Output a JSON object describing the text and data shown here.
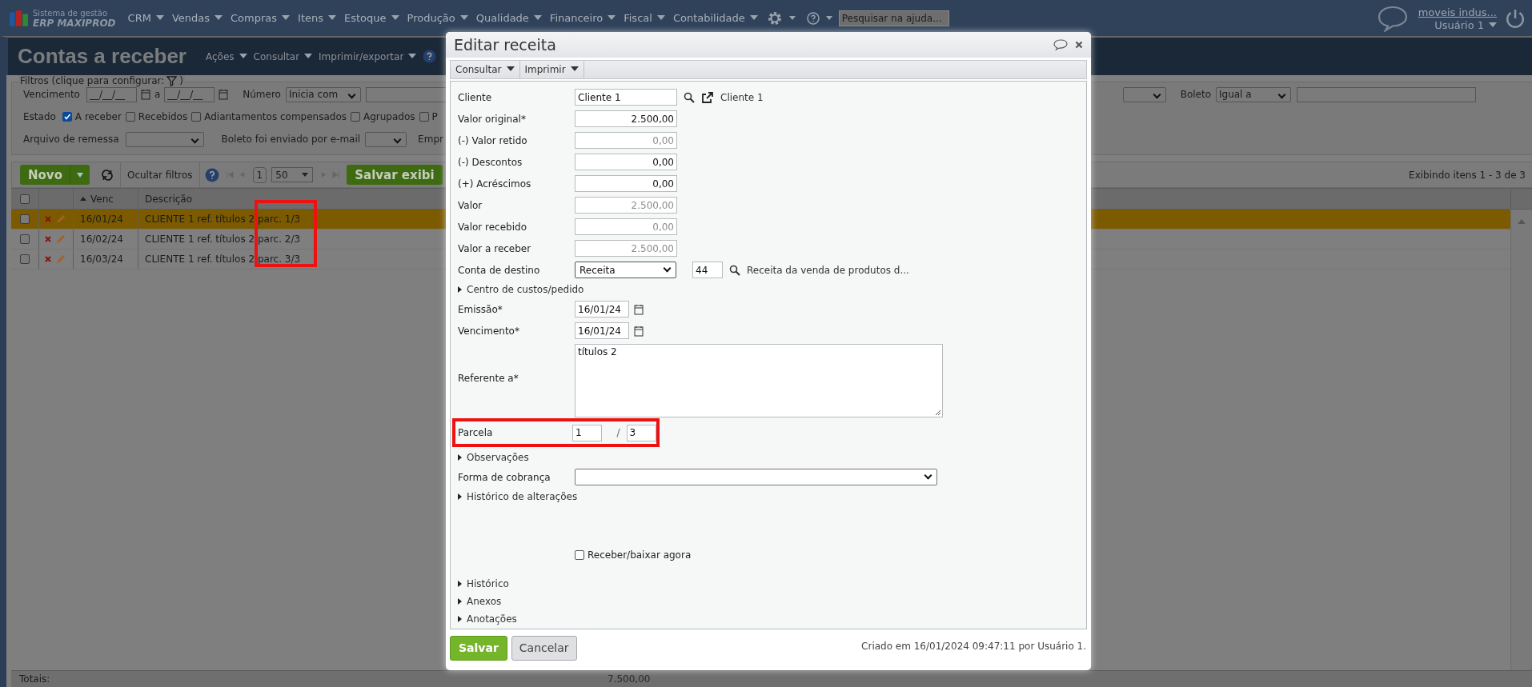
{
  "nav": {
    "logo_line1": "Sistema de gestão",
    "logo_line2": "ERP MAXIPROD",
    "menus": [
      "CRM",
      "Vendas",
      "Compras",
      "Itens",
      "Estoque",
      "Produção",
      "Qualidade",
      "Financeiro",
      "Fiscal",
      "Contabilidade"
    ],
    "search": {
      "placeholder": "Pesquisar na ajuda..."
    },
    "company": "moveis indus...",
    "user": "Usuário 1"
  },
  "page": {
    "title": "Contas a receber",
    "menus": [
      "Ações",
      "Consultar",
      "Imprimir/exportar"
    ]
  },
  "filters": {
    "legend": "Filtros (clique para configurar:",
    "legend_end": ")",
    "vencimento_label": "Vencimento",
    "date_from": "__/__/__",
    "date_sep": "a",
    "date_to": "__/__/__",
    "numero_label": "Número",
    "numero_mode": "Inicia com",
    "boleto_label": "Boleto",
    "boleto_mode": "Igual a",
    "estado_label": "Estado",
    "estado": [
      {
        "label": "A receber",
        "checked": true
      },
      {
        "label": "Recebidos",
        "checked": false
      },
      {
        "label": "Adiantamentos compensados",
        "checked": false
      },
      {
        "label": "Agrupados",
        "checked": false
      },
      {
        "label": "P",
        "checked": false
      }
    ],
    "remessa_label": "Arquivo de remessa",
    "email_label": "Boleto foi enviado por e-mail",
    "empresa_label": "Empr"
  },
  "toolbar": {
    "new": "Novo",
    "hide_filters": "Ocultar filtros",
    "page": "1",
    "page_size": "50",
    "save_view": "Salvar exibi",
    "count": "Exibindo itens 1 - 3 de 3"
  },
  "table": {
    "columns": [
      "Venc",
      "Descrição"
    ],
    "select_all_checked": false,
    "rows": [
      {
        "venc": "16/01/24",
        "descricao": "CLIENTE 1 ref. títulos 2 parc. 1/3",
        "selected": true,
        "checked": false
      },
      {
        "venc": "16/02/24",
        "descricao": "CLIENTE 1 ref. títulos 2 parc. 2/3",
        "selected": false,
        "checked": false
      },
      {
        "venc": "16/03/24",
        "descricao": "CLIENTE 1 ref. títulos 2 parc. 3/3",
        "selected": false,
        "checked": false
      }
    ],
    "totals_label": "Totais:",
    "total": "7.500,00"
  },
  "dialog": {
    "title": "Editar receita",
    "menus": [
      "Consultar",
      "Imprimir"
    ],
    "fields": [
      {
        "kind": "lookup",
        "label": "Cliente",
        "value": "Cliente 1",
        "link": "Cliente 1"
      },
      {
        "kind": "number",
        "label": "Valor original*",
        "value": "2.500,00",
        "disabled": false
      },
      {
        "kind": "number",
        "label": "(-) Valor retido",
        "value": "0,00",
        "disabled": true
      },
      {
        "kind": "number",
        "label": "(-) Descontos",
        "value": "0,00",
        "disabled": false
      },
      {
        "kind": "number",
        "label": "(+) Acréscimos",
        "value": "0,00",
        "disabled": false
      },
      {
        "kind": "number",
        "label": "Valor",
        "value": "2.500,00",
        "disabled": true
      },
      {
        "kind": "number",
        "label": "Valor recebido",
        "value": "0,00",
        "disabled": true
      },
      {
        "kind": "number",
        "label": "Valor a receber",
        "value": "2.500,00",
        "disabled": true
      },
      {
        "kind": "account",
        "label": "Conta de destino",
        "value": "Receita",
        "code": "44",
        "description": "Receita da venda de produtos d..."
      },
      {
        "kind": "section",
        "label": "Centro de custos/pedido"
      },
      {
        "kind": "date",
        "label": "Emissão*",
        "value": "16/01/24"
      },
      {
        "kind": "date",
        "label": "Vencimento*",
        "value": "16/01/24"
      },
      {
        "kind": "textarea",
        "label": "Referente a*",
        "value": "títulos 2"
      },
      {
        "kind": "parcela",
        "label": "Parcela",
        "value": "1",
        "separator": "/",
        "total": "3"
      },
      {
        "kind": "section",
        "label": "Observações"
      },
      {
        "kind": "select",
        "label": "Forma de cobrança"
      },
      {
        "kind": "section",
        "label": "Histórico de alterações"
      },
      {
        "kind": "checkbox",
        "label": "Receber/baixar agora",
        "checked": false
      },
      {
        "kind": "section",
        "label": "Histórico"
      },
      {
        "kind": "section",
        "label": "Anexos"
      },
      {
        "kind": "section",
        "label": "Anotações"
      }
    ],
    "created": "Criado em 16/01/2024 09:47:11 por Usuário 1.",
    "save": "Salvar",
    "cancel": "Cancelar"
  }
}
